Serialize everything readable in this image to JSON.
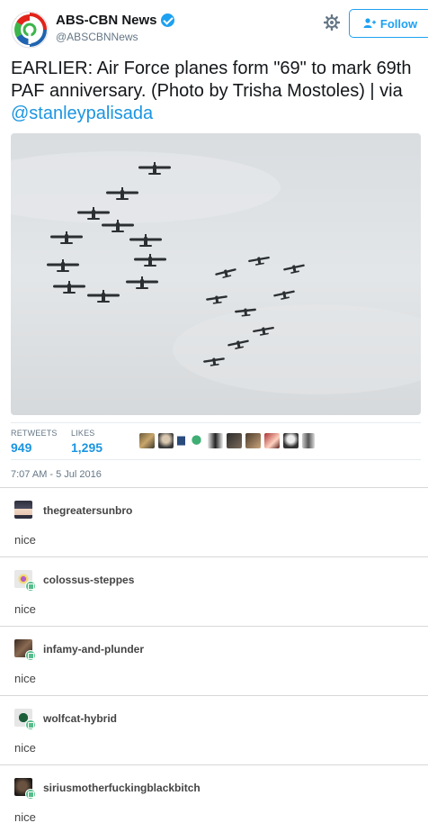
{
  "tweet": {
    "account_name": "ABS-CBN News",
    "handle": "@ABSCBNNews",
    "follow_label": "Follow",
    "text_main": "EARLIER: Air Force planes form \"69\" to mark 69th PAF anniversary. (Photo by Trisha Mostoles) | via ",
    "text_mention": "@stanleypalisada",
    "photo_icon": "planes-formation-photo",
    "retweets_label": "RETWEETS",
    "retweets_value": "949",
    "likes_label": "LIKES",
    "likes_value": "1,295",
    "timestamp": "7:07 AM - 5 Jul 2016"
  },
  "replies": [
    {
      "user": "thegreatersunbro",
      "body": "nice",
      "reblog": false
    },
    {
      "user": "colossus-steppes",
      "body": "nice",
      "reblog": true
    },
    {
      "user": "infamy-and-plunder",
      "body": "nice",
      "reblog": true
    },
    {
      "user": "wolfcat-hybrid",
      "body": "nice",
      "reblog": true
    },
    {
      "user": "siriusmotherfuckingblackbitch",
      "body": "nice",
      "reblog": true
    }
  ],
  "colors": {
    "accent": "#1da1f2",
    "link": "#1b95e0",
    "reblog": "#56bc8a"
  }
}
